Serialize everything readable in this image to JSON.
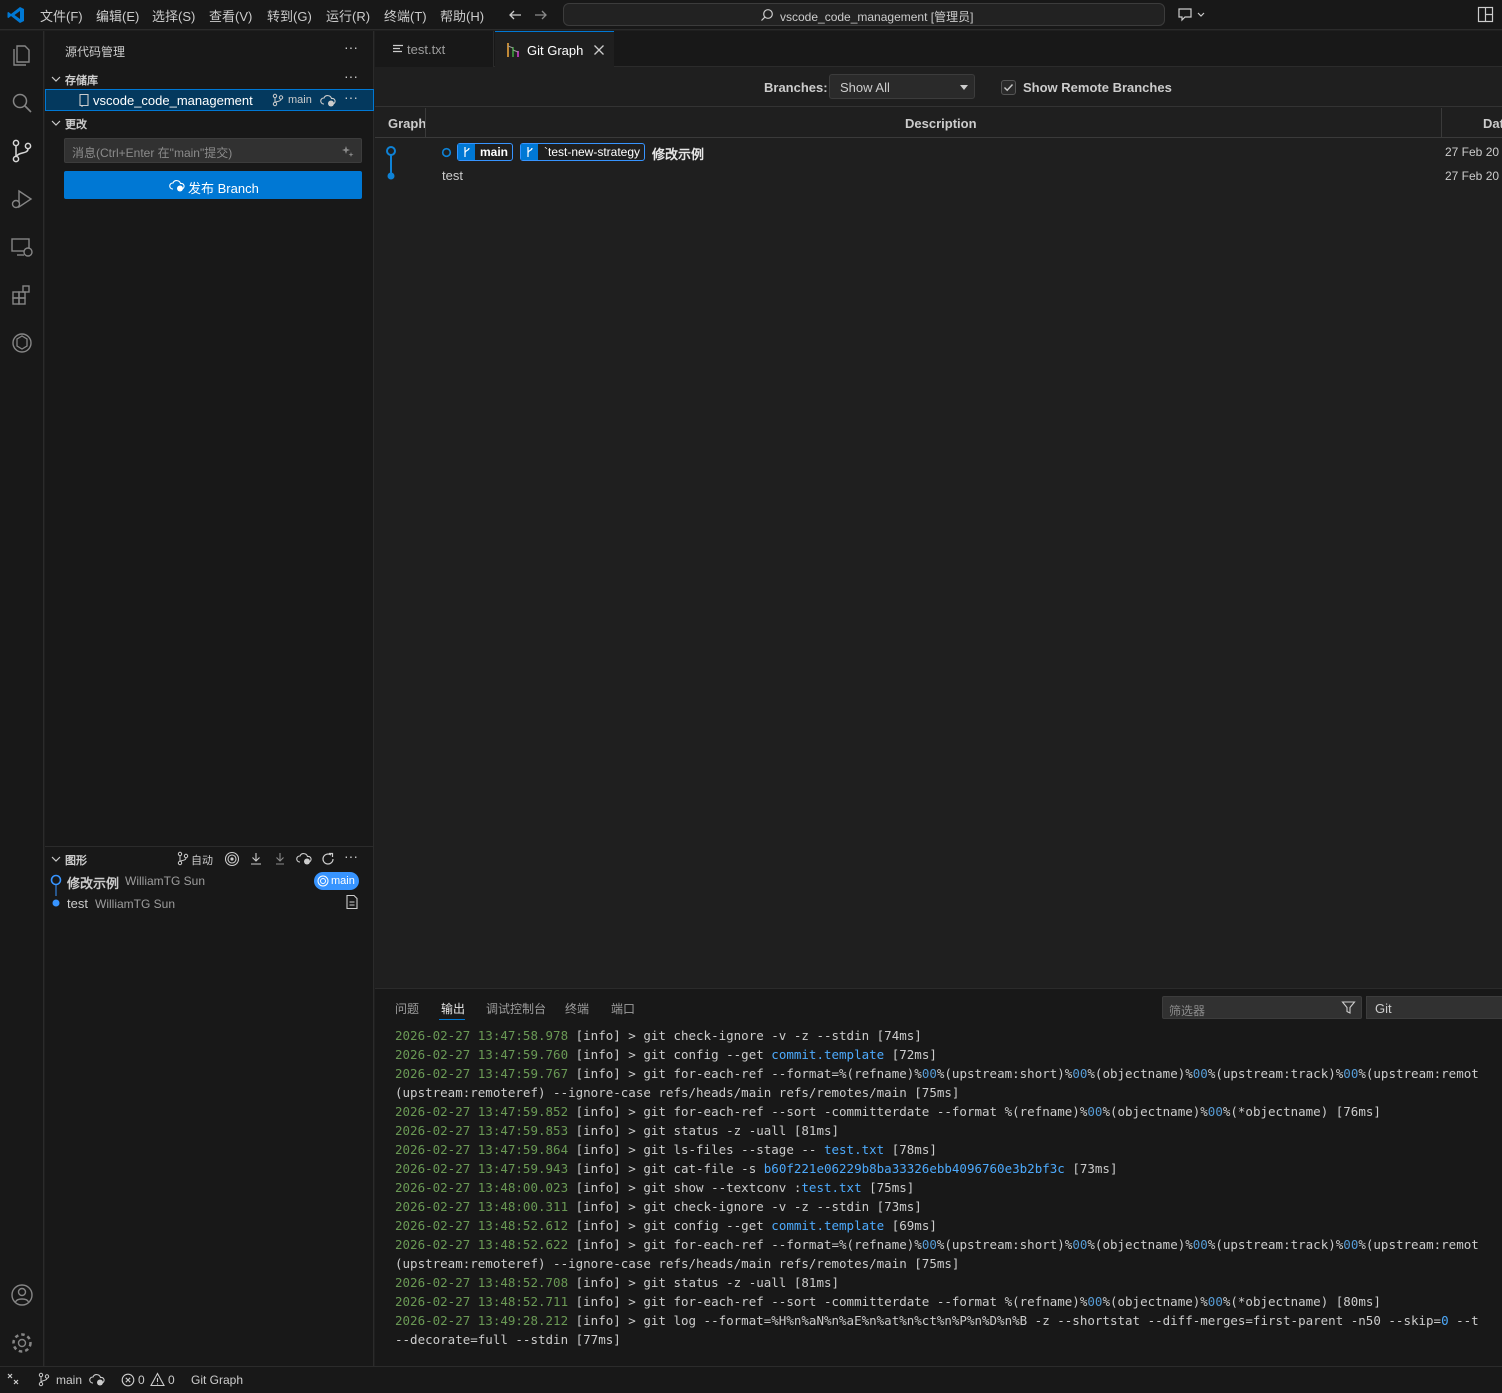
{
  "titlebar": {
    "menu": [
      "文件(F)",
      "编辑(E)",
      "选择(S)",
      "查看(V)",
      "转到(G)",
      "运行(R)",
      "终端(T)",
      "帮助(H)"
    ],
    "search_text": "vscode_code_management [管理员]"
  },
  "sidebar": {
    "title": "源代码管理",
    "repos_section": "存储库",
    "repo_name": "vscode_code_management",
    "repo_branch": "main",
    "changes_section": "更改",
    "commit_placeholder": "消息(Ctrl+Enter 在\"main\"提交)",
    "publish_label": "发布 Branch",
    "graph_section": "图形",
    "graph_auto_label": "自动",
    "graph_commits": [
      {
        "message": "修改示例",
        "author": "WilliamTG Sun",
        "ref": "main"
      },
      {
        "message": "test",
        "author": "WilliamTG Sun"
      }
    ]
  },
  "tabs": [
    {
      "label": "test.txt",
      "active": false
    },
    {
      "label": "Git Graph",
      "active": true
    }
  ],
  "git_graph": {
    "branches_label": "Branches:",
    "branches_value": "Show All",
    "show_remote_label": "Show Remote Branches",
    "show_remote_checked": true,
    "columns": [
      "Graph",
      "Description",
      "Dat"
    ],
    "rows": [
      {
        "refs": [
          "main",
          "`test-new-strategy"
        ],
        "description": "修改示例",
        "date": "27 Feb 20"
      },
      {
        "refs": [],
        "description": "test",
        "date": "27 Feb 20"
      }
    ]
  },
  "panel": {
    "tabs": [
      "问题",
      "输出",
      "调试控制台",
      "终端",
      "端口"
    ],
    "active_tab": "输出",
    "filter_placeholder": "筛选器",
    "channel": "Git",
    "log": [
      [
        {
          "c": "ts",
          "t": "2026-02-27 13:47:58.978"
        },
        {
          "t": " [info] > git check-ignore -v -z --stdin [74ms]"
        }
      ],
      [
        {
          "c": "ts",
          "t": "2026-02-27 13:47:59.760"
        },
        {
          "t": " [info] > git config --get "
        },
        {
          "c": "lnk",
          "t": "commit.template"
        },
        {
          "t": " [72ms]"
        }
      ],
      [
        {
          "c": "ts",
          "t": "2026-02-27 13:47:59.767"
        },
        {
          "t": " [info] > git for-each-ref --format=%(refname)%"
        },
        {
          "c": "dim",
          "t": "00"
        },
        {
          "t": "%(upstream:short)%"
        },
        {
          "c": "dim",
          "t": "00"
        },
        {
          "t": "%(objectname)%"
        },
        {
          "c": "dim",
          "t": "00"
        },
        {
          "t": "%(upstream:track)%"
        },
        {
          "c": "dim",
          "t": "00"
        },
        {
          "t": "%(upstream:remot"
        }
      ],
      [
        {
          "t": "(upstream:remoteref) --ignore-case refs/heads/main refs/remotes/main [75ms]"
        }
      ],
      [
        {
          "c": "ts",
          "t": "2026-02-27 13:47:59.852"
        },
        {
          "t": " [info] > git for-each-ref --sort -committerdate --format %(refname)%"
        },
        {
          "c": "dim",
          "t": "00"
        },
        {
          "t": "%(objectname)%"
        },
        {
          "c": "dim",
          "t": "00"
        },
        {
          "t": "%(*objectname) [76ms]"
        }
      ],
      [
        {
          "c": "ts",
          "t": "2026-02-27 13:47:59.853"
        },
        {
          "t": " [info] > git status -z -uall [81ms]"
        }
      ],
      [
        {
          "c": "ts",
          "t": "2026-02-27 13:47:59.864"
        },
        {
          "t": " [info] > git ls-files --stage -- "
        },
        {
          "c": "lnk",
          "t": "test.txt"
        },
        {
          "t": " [78ms]"
        }
      ],
      [
        {
          "c": "ts",
          "t": "2026-02-27 13:47:59.943"
        },
        {
          "t": " [info] > git cat-file -s "
        },
        {
          "c": "lnk",
          "t": "b60f221e06229b8ba33326ebb4096760e3b2bf3c"
        },
        {
          "t": " [73ms]"
        }
      ],
      [
        {
          "c": "ts",
          "t": "2026-02-27 13:48:00.023"
        },
        {
          "t": " [info] > git show --textconv :"
        },
        {
          "c": "lnk",
          "t": "test.txt"
        },
        {
          "t": " [75ms]"
        }
      ],
      [
        {
          "c": "ts",
          "t": "2026-02-27 13:48:00.311"
        },
        {
          "t": " [info] > git check-ignore -v -z --stdin [73ms]"
        }
      ],
      [
        {
          "c": "ts",
          "t": "2026-02-27 13:48:52.612"
        },
        {
          "t": " [info] > git config --get "
        },
        {
          "c": "lnk",
          "t": "commit.template"
        },
        {
          "t": " [69ms]"
        }
      ],
      [
        {
          "c": "ts",
          "t": "2026-02-27 13:48:52.622"
        },
        {
          "t": " [info] > git for-each-ref --format=%(refname)%"
        },
        {
          "c": "dim",
          "t": "00"
        },
        {
          "t": "%(upstream:short)%"
        },
        {
          "c": "dim",
          "t": "00"
        },
        {
          "t": "%(objectname)%"
        },
        {
          "c": "dim",
          "t": "00"
        },
        {
          "t": "%(upstream:track)%"
        },
        {
          "c": "dim",
          "t": "00"
        },
        {
          "t": "%(upstream:remot"
        }
      ],
      [
        {
          "t": "(upstream:remoteref) --ignore-case refs/heads/main refs/remotes/main [75ms]"
        }
      ],
      [
        {
          "c": "ts",
          "t": "2026-02-27 13:48:52.708"
        },
        {
          "t": " [info] > git status -z -uall [81ms]"
        }
      ],
      [
        {
          "c": "ts",
          "t": "2026-02-27 13:48:52.711"
        },
        {
          "t": " [info] > git for-each-ref --sort -committerdate --format %(refname)%"
        },
        {
          "c": "dim",
          "t": "00"
        },
        {
          "t": "%(objectname)%"
        },
        {
          "c": "dim",
          "t": "00"
        },
        {
          "t": "%(*objectname) [80ms]"
        }
      ],
      [
        {
          "c": "ts",
          "t": "2026-02-27 13:49:28.212"
        },
        {
          "t": " [info] > git log --format=%H%n%aN%n%aE%n%at%n%ct%n%P%n%D%n%B -z --shortstat --diff-merges=first-parent -n50 --skip="
        },
        {
          "c": "lnk",
          "t": "0"
        },
        {
          "t": " --t"
        }
      ],
      [
        {
          "t": "--decorate=full --stdin [77ms]"
        }
      ]
    ]
  },
  "statusbar": {
    "branch": "main",
    "errors": "0",
    "warnings": "0",
    "git_graph": "Git Graph"
  },
  "colors": {
    "accent": "#0078d4",
    "link": "#3794ff",
    "timestamp": "#6a9955"
  }
}
